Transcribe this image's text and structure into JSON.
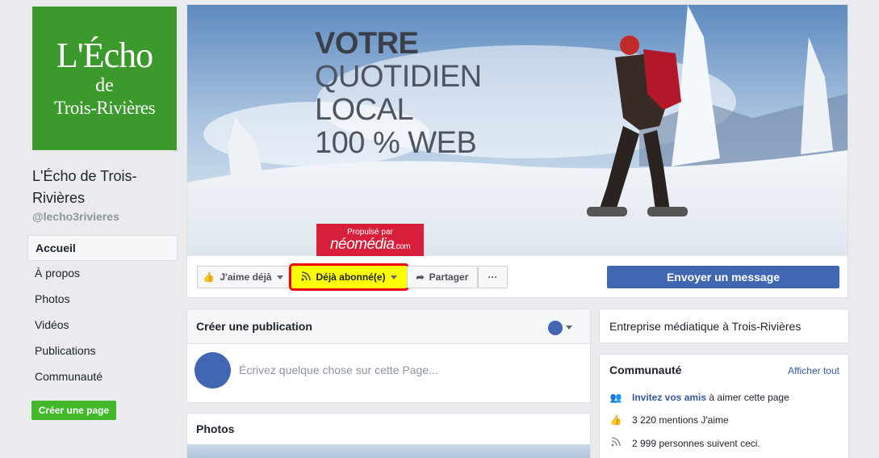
{
  "logo": {
    "line1": "L'Écho",
    "line2": "de",
    "line3": "Trois-Rivières"
  },
  "page": {
    "name": "L'Écho de Trois-Rivières",
    "handle": "@lecho3rivieres"
  },
  "nav": {
    "items": [
      {
        "label": "Accueil",
        "active": true
      },
      {
        "label": "À propos"
      },
      {
        "label": "Photos"
      },
      {
        "label": "Vidéos"
      },
      {
        "label": "Publications"
      },
      {
        "label": "Communauté"
      }
    ],
    "create_page": "Créer une page"
  },
  "cover": {
    "line1": "VOTRE",
    "line2": "QUOTIDIEN",
    "line3": "LOCAL",
    "line4": "100 % WEB",
    "badge_top": "Propulsé par",
    "badge_brand": "néomédia",
    "badge_tld": ".com"
  },
  "actions": {
    "like": "J'aime déjà",
    "subscribed": "Déjà abonné(e)",
    "share": "Partager",
    "more": "···",
    "send_message": "Envoyer un message"
  },
  "create_post": {
    "title": "Créer une publication",
    "placeholder": "Écrivez quelque chose sur cette Page..."
  },
  "photos": {
    "title": "Photos"
  },
  "about": {
    "text": "Entreprise médiatique à Trois-Rivières"
  },
  "community": {
    "title": "Communauté",
    "see_all": "Afficher tout",
    "invite_link": "Invitez vos amis",
    "invite_rest": "à aimer cette page",
    "likes": "3 220 mentions J'aime",
    "followers": "2 999 personnes suivent ceci."
  },
  "colors": {
    "brand_green": "#3c9a2d",
    "facebook_blue": "#4267b2",
    "highlight": "#ffff00",
    "highlight_border": "#ee0000",
    "neomedia_red": "#d71f3b"
  }
}
